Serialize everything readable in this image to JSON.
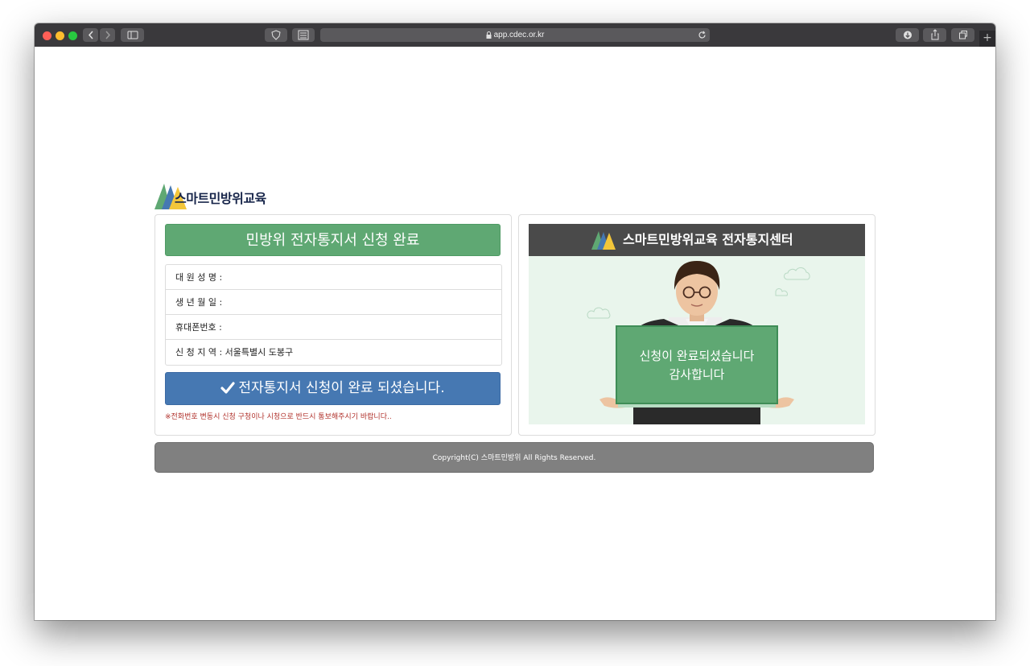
{
  "browser": {
    "url": "app.cdec.or.kr"
  },
  "brand": {
    "name": "스마트민방위교육"
  },
  "left_panel": {
    "title": "민방위 전자통지서 신청 완료",
    "fields": [
      {
        "label": "대 원 성 명 :"
      },
      {
        "label": "생 년 월 일 :"
      },
      {
        "label": "휴대폰번호 :"
      },
      {
        "label": "신 청 지 역 : 서울특별시 도봉구"
      }
    ],
    "button_label": "전자통지서 신청이 완료 되셨습니다.",
    "notice": "※전화번호 변동시 신청 구청이나 시청으로 반드시 통보해주시기 바랍니다.."
  },
  "right_panel": {
    "header_title": "스마트민방위교육 전자통지센터",
    "sign_line1": "신청이 완료되셨습니다",
    "sign_line2": "감사합니다"
  },
  "footer": {
    "copyright": "Copyright(C) 스마트민방위 All Rights Reserved."
  },
  "colors": {
    "green": "#5fa873",
    "blue": "#4678b2",
    "dark_header": "#4a4a4a",
    "footer": "#808080"
  }
}
